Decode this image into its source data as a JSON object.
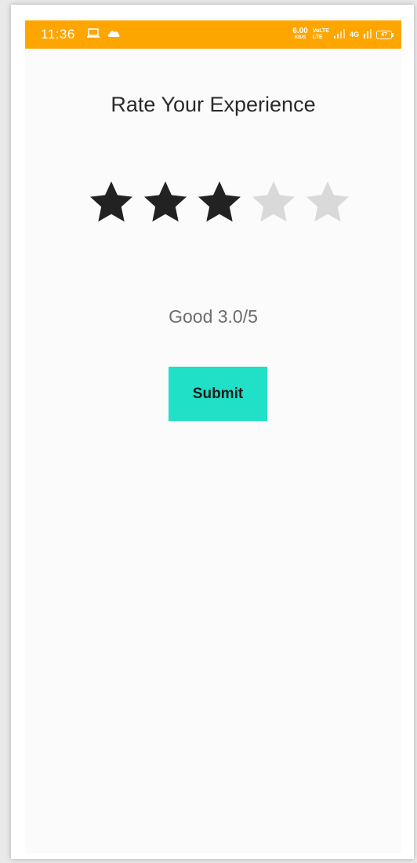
{
  "status_bar": {
    "time": "11:36",
    "net_speed_value": "6.00",
    "net_speed_unit": "KB/S",
    "volte_top": "VoLTE",
    "volte_bottom": "LTE",
    "network_type": "4G",
    "battery_level": "47",
    "left_icons": [
      "laptop-icon",
      "cloud-icon"
    ],
    "right_icons": [
      "signal-icon",
      "signal-icon-2"
    ],
    "background_color": "#ffa500"
  },
  "main": {
    "title": "Rate Your Experience",
    "rating": {
      "max": 5,
      "value": 3,
      "filled_color": "#222222",
      "empty_color": "#d9d9d9"
    },
    "rating_text": "Good 3.0/5",
    "submit_label": "Submit",
    "submit_color": "#20e0c8"
  }
}
